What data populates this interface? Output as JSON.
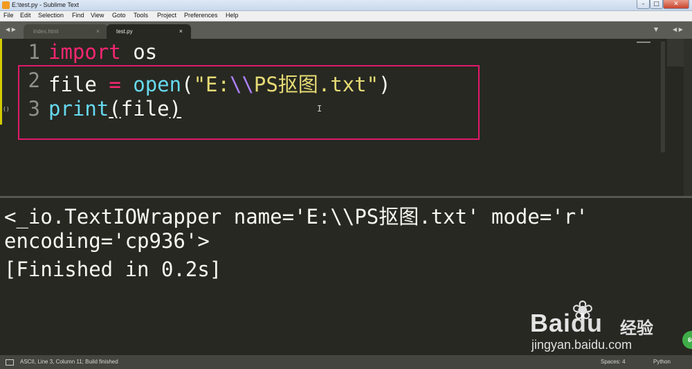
{
  "window": {
    "title": "E:\\test.py - Sublime Text",
    "minimize": "–",
    "maximize": "□",
    "close": "✕"
  },
  "menu": [
    "File",
    "Edit",
    "Selection",
    "Find",
    "View",
    "Goto",
    "Tools",
    "Project",
    "Preferences",
    "Help"
  ],
  "tabs": {
    "nav": "◀ ▶",
    "items": [
      {
        "label": "index.html",
        "close": "×",
        "active": false
      },
      {
        "label": "test.py",
        "close": "×",
        "active": true
      }
    ],
    "dropdown": "▼",
    "right_nav": "◀ ▶"
  },
  "editor": {
    "gutter": [
      "1",
      "2",
      "3"
    ],
    "line1": {
      "kw": "import",
      "rest": " os"
    },
    "line2": {
      "var": "file ",
      "op": "=",
      "sp": " ",
      "fn": "open",
      "p1": "(",
      "q1": "\"E:",
      "esc": "\\\\",
      "q2": "PS抠图.txt\"",
      "p2": ")"
    },
    "line3": {
      "fn": "print",
      "p1": "(",
      "arg": "file",
      "p2": ")"
    },
    "fold_marker": "()",
    "ibeam": "I"
  },
  "output": [
    "<_io.TextIOWrapper name='E:\\\\PS抠图.txt' mode='r'",
    "encoding='cp936'>",
    "[Finished in 0.2s]"
  ],
  "watermark": {
    "paws": "❀",
    "brand_bai": "Bai",
    "brand_du": "du",
    "brand_cn": "经验",
    "url": "jingyan.baidu.com",
    "badge": "60"
  },
  "status": {
    "left": "ASCII, Line 3, Column 11; Build finished",
    "spaces": "Spaces: 4",
    "syntax": "Python"
  },
  "colors": {
    "background": "#272822",
    "keyword": "#f92672",
    "function": "#66d9ef",
    "string": "#e6db74",
    "escape": "#ae81ff",
    "annotation_box": "#e0196c"
  }
}
